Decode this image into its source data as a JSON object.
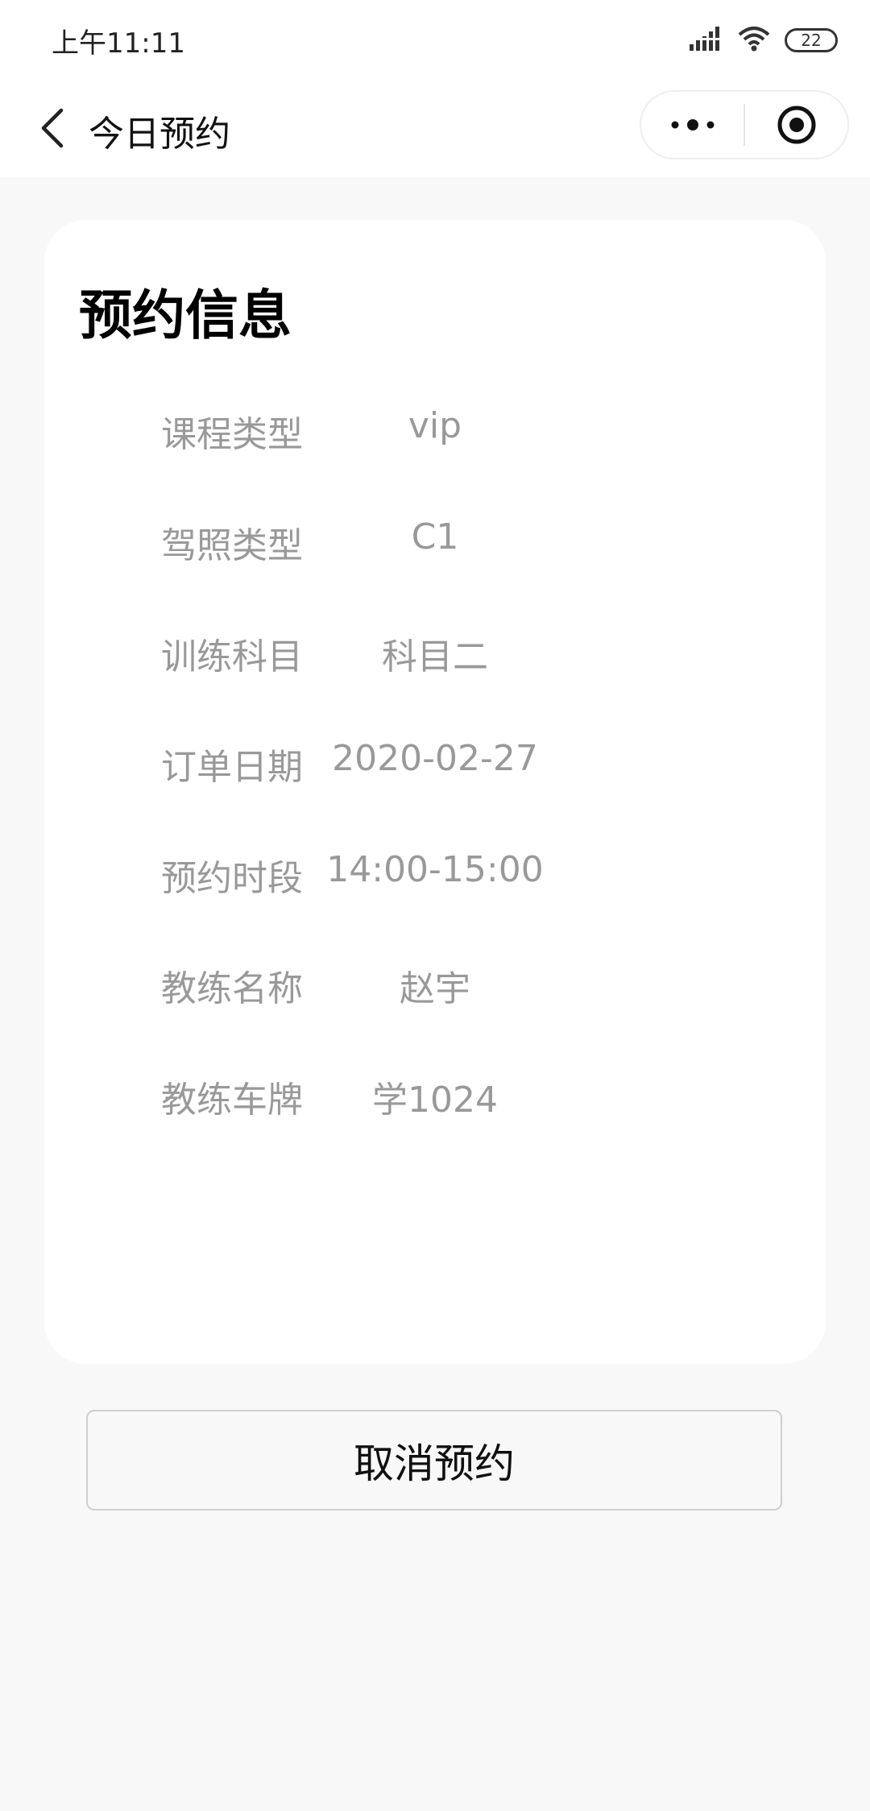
{
  "status_bar": {
    "time": "上午11:11",
    "battery": "22"
  },
  "nav": {
    "title": "今日预约"
  },
  "card": {
    "title": "预约信息",
    "rows": [
      {
        "label": "课程类型",
        "value": "vip"
      },
      {
        "label": "驾照类型",
        "value": "C1"
      },
      {
        "label": "训练科目",
        "value": "科目二"
      },
      {
        "label": "订单日期",
        "value": "2020-02-27"
      },
      {
        "label": "预约时段",
        "value": "14:00-15:00"
      },
      {
        "label": "教练名称",
        "value": "赵宇"
      },
      {
        "label": "教练车牌",
        "value": "学1024"
      }
    ]
  },
  "actions": {
    "cancel_label": "取消预约"
  }
}
